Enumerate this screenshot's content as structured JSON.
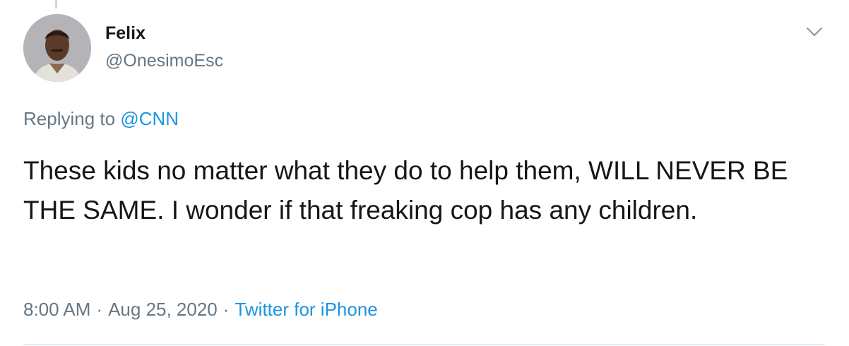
{
  "tweet": {
    "author": {
      "name": "Felix",
      "handle": "@OnesimoEsc"
    },
    "reply": {
      "prefix": "Replying to",
      "mention": "@CNN"
    },
    "text": "These kids no matter what they do to help them, WILL NEVER BE THE SAME. I wonder if that freaking cop has any children.",
    "meta": {
      "time": "8:00 AM",
      "separator": "·",
      "date": "Aug 25, 2020",
      "source": "Twitter for iPhone"
    },
    "menu_icon": "chevron-down-icon"
  },
  "colors": {
    "primary_text": "#14171a",
    "secondary_text": "#657786",
    "link": "#1b95e0",
    "divider": "#e6ecf0"
  }
}
